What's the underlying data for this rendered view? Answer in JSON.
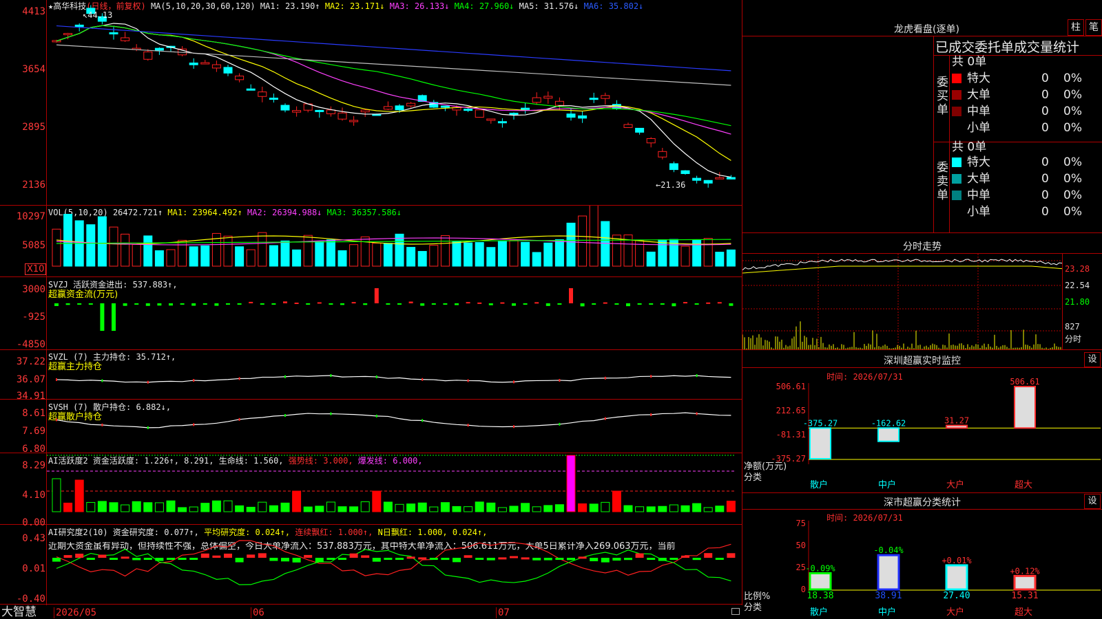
{
  "app": {
    "brand": "大智慧"
  },
  "chart_header": {
    "star": "★",
    "name": "高华科技",
    "period": "(日线，前复权)",
    "ma_label": "MA(5,10,20,30,60,120)",
    "ma1": "MA1: 23.190↑",
    "ma2": "MA2: 23.171↓",
    "ma3": "MA3: 26.133↓",
    "ma4": "MA4: 27.960↓",
    "ma5": "MA5: 31.576↓",
    "ma6": "MA6: 35.802↓"
  },
  "price_axis": [
    "4413",
    "3654",
    "2895",
    "2136"
  ],
  "high_label": "44.13",
  "low_label": "←21.36",
  "vol_header": {
    "label": "VOL(5,10,20)",
    "v": "26472.721↑",
    "ma1": "MA1: 23964.492↑",
    "ma2": "MA2: 26394.988↓",
    "ma3": "MA3: 36357.586↓"
  },
  "vol_axis": [
    "10297",
    "5085"
  ],
  "vol_unit": "X10",
  "svzj": {
    "label": "SVZJ  活跃资金进出: 537.883↑,",
    "sub": "超赢资金流(万元)",
    "axis": [
      "3000",
      "-925",
      "-4850"
    ]
  },
  "svzl": {
    "label": "SVZL (7) 主力持仓: 35.712↑,",
    "sub": "超赢主力持仓",
    "axis": [
      "37.22",
      "36.07",
      "34.91"
    ]
  },
  "svsh": {
    "label": "SVSH (7) 散户持仓: 6.882↓,",
    "sub": "超赢散户持仓",
    "axis": [
      "8.61",
      "7.69",
      "6.80"
    ]
  },
  "ai2": {
    "label": "AI活跃度2 资金活跃度: 1.226↑, 8.291, 生命线: 1.560,",
    "strong": "强势线: 3.000,",
    "burst": "爆发线: 6.000,",
    "axis": [
      "8.29",
      "4.10",
      "0.00"
    ]
  },
  "ai_research": {
    "label": "AI研究度2(10) 资金研究度: 0.077↑,",
    "avg": "平均研究度: 0.024↑,",
    "cont": "连续飘红: 1.000↑,",
    "nday": "N日飘红: 1.000, 0.024↑,",
    "text": "近期大资金虽有异动，但持续性不强，总体偏空，今日大单净流入：537.883万元，其中特大单净流入：506.611万元，大单5日累计净入269.063万元，当前",
    "axis": [
      "0.43",
      "0.01",
      "-0.40"
    ]
  },
  "date_axis": [
    "2026/05",
    "06",
    "07"
  ],
  "lhb": {
    "title": "龙虎看盘(逐单)",
    "btn_zhu": "柱",
    "btn_bi": "笔",
    "subtitle": "已成交委托单成交量统计",
    "buy": {
      "side": "委买单",
      "total": "共 0单",
      "rows": [
        {
          "name": "特大",
          "n": "0",
          "p": "0%"
        },
        {
          "name": "大单",
          "n": "0",
          "p": "0%"
        },
        {
          "name": "中单",
          "n": "0",
          "p": "0%"
        },
        {
          "name": "小单",
          "n": "0",
          "p": "0%"
        }
      ]
    },
    "sell": {
      "side": "委卖单",
      "total": "共 0单",
      "rows": [
        {
          "name": "特大",
          "n": "0",
          "p": "0%"
        },
        {
          "name": "大单",
          "n": "0",
          "p": "0%"
        },
        {
          "name": "中单",
          "n": "0",
          "p": "0%"
        },
        {
          "name": "小单",
          "n": "0",
          "p": "0%"
        }
      ]
    },
    "colors": {
      "buy": [
        "#ff0000",
        "#990000",
        "#800000",
        "#000000"
      ],
      "sell": [
        "#00ffff",
        "#00a0a0",
        "#008080",
        "#000000"
      ]
    }
  },
  "intraday": {
    "title": "分时走势",
    "axis": [
      "23.28",
      "22.54",
      "21.80"
    ],
    "vol": "827",
    "unit": "分时"
  },
  "monitor": {
    "title": "深圳超赢实时监控",
    "btn": "设",
    "time": "时间: 2026/07/31",
    "axis": [
      "506.61",
      "212.65",
      "-81.31",
      "-375.27"
    ],
    "ylabel": "净额(万元)",
    "xlabel": "分类",
    "cats": [
      "散户",
      "中户",
      "大户",
      "超大"
    ],
    "labels": [
      "-375.27",
      "-162.62",
      "31.27",
      "506.61"
    ],
    "values": [
      -375.27,
      -162.62,
      31.27,
      506.61
    ]
  },
  "stats": {
    "title": "深市超赢分类统计",
    "btn": "设",
    "time": "时间: 2026/07/31",
    "axis": [
      "75",
      "50",
      "25",
      "0"
    ],
    "ylabel": "比例%",
    "xlabel": "分类",
    "cats": [
      "散户",
      "中户",
      "大户",
      "超大"
    ],
    "values": [
      18.38,
      38.91,
      27.4,
      15.31
    ],
    "changes": [
      "-0.09%",
      "-0.04%",
      "+0.01%",
      "+0.12%"
    ],
    "vals_text": [
      "18.38",
      "38.91",
      "27.40",
      "15.31"
    ]
  }
}
